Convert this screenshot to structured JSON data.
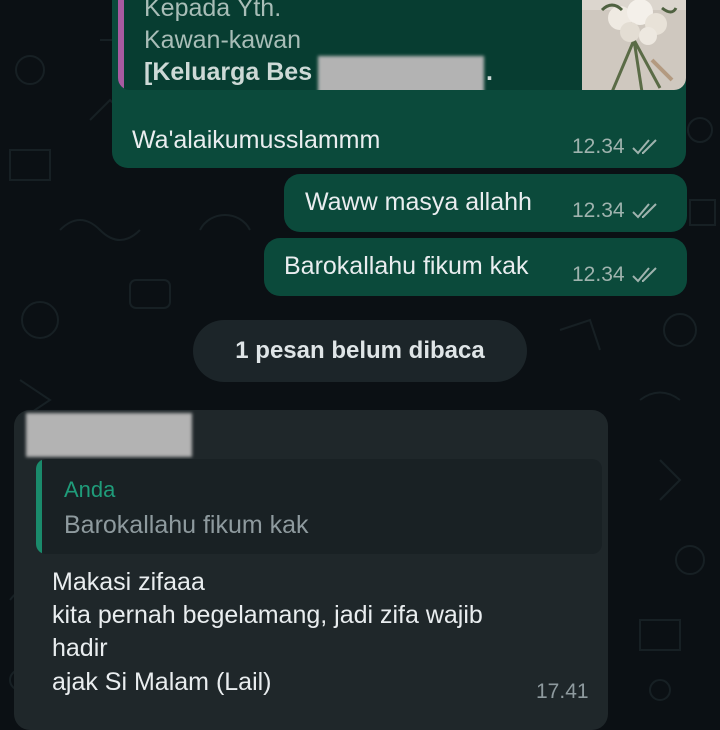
{
  "colors": {
    "background": "#0b1014",
    "outgoing_bubble": "#0b4a3b",
    "incoming_bubble": "#1f272a",
    "quote_author": "#1f9c7a",
    "read_ticks": "#9fb3ae"
  },
  "messages": [
    {
      "direction": "outgoing",
      "quote": {
        "lines": [
          "Kepada Yth.",
          "Kawan-kawan"
        ],
        "bold_line": "[Keluarga Bes",
        "bold_suffix": ".",
        "thumbnail": "flower-bouquet-photo"
      },
      "text": "Wa'alaikumusslammm",
      "time": "12.34",
      "status": "read-double-check"
    },
    {
      "direction": "outgoing",
      "text": "Waww masya allahh",
      "time": "12.34",
      "status": "read-double-check"
    },
    {
      "direction": "outgoing",
      "text": "Barokallahu fikum kak",
      "time": "12.34",
      "status": "read-double-check"
    }
  ],
  "unread_divider": "1 pesan belum dibaca",
  "incoming": {
    "reply_to": {
      "author": "Anda",
      "text": "Barokallahu fikum kak"
    },
    "lines": [
      "Makasi zifaaa",
      "kita pernah begelamang, jadi zifa wajib",
      "hadir",
      "ajak Si Malam (Lail)"
    ],
    "time": "17.41"
  }
}
